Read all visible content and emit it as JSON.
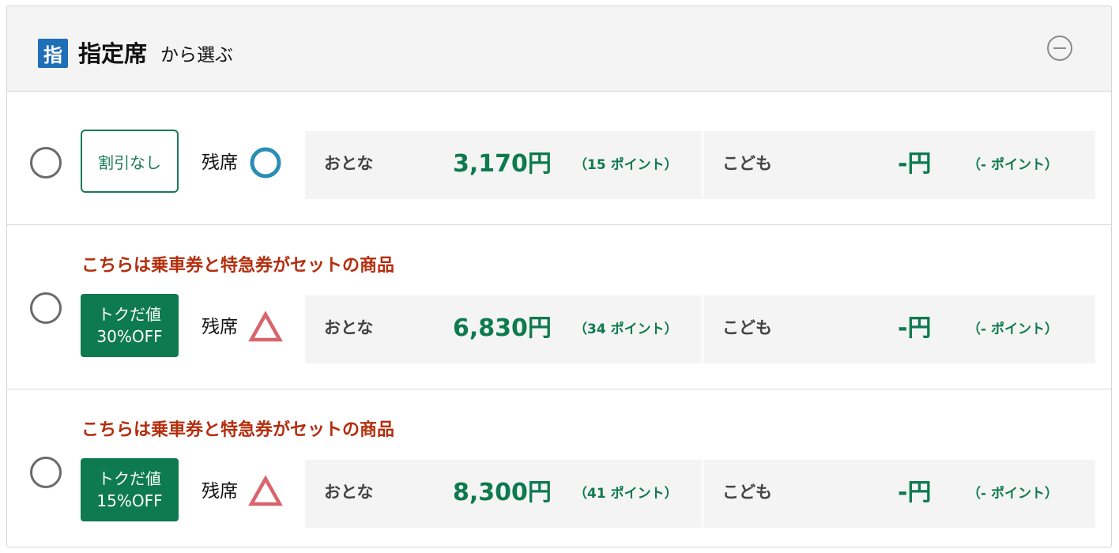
{
  "header": {
    "badge": "指",
    "title": "指定席",
    "subtitle": "から選ぶ",
    "collapse_icon": "minus-circle-icon"
  },
  "colors": {
    "accent_green": "#0e7a4f",
    "notice_red": "#b42e0e",
    "badge_blue": "#1f6eb8",
    "available_circle": "#2a8db4",
    "few_triangle": "#d9646b"
  },
  "rows": [
    {
      "notice": "",
      "tag_line1": "割引なし",
      "tag_line2": "",
      "seat_label": "残席",
      "seat_status_icon": "circle-available-icon",
      "adult_label": "おとな",
      "adult_price": "3,170円",
      "adult_points": "（15 ポイント）",
      "child_label": "こども",
      "child_price": "-円",
      "child_points": "（- ポイント）"
    },
    {
      "notice": "こちらは乗車券と特急券がセットの商品",
      "tag_line1": "トクだ値",
      "tag_line2": "30%OFF",
      "seat_label": "残席",
      "seat_status_icon": "triangle-few-seats-icon",
      "adult_label": "おとな",
      "adult_price": "6,830円",
      "adult_points": "（34 ポイント）",
      "child_label": "こども",
      "child_price": "-円",
      "child_points": "（- ポイント）"
    },
    {
      "notice": "こちらは乗車券と特急券がセットの商品",
      "tag_line1": "トクだ値",
      "tag_line2": "15%OFF",
      "seat_label": "残席",
      "seat_status_icon": "triangle-few-seats-icon",
      "adult_label": "おとな",
      "adult_price": "8,300円",
      "adult_points": "（41 ポイント）",
      "child_label": "こども",
      "child_price": "-円",
      "child_points": "（- ポイント）"
    }
  ]
}
